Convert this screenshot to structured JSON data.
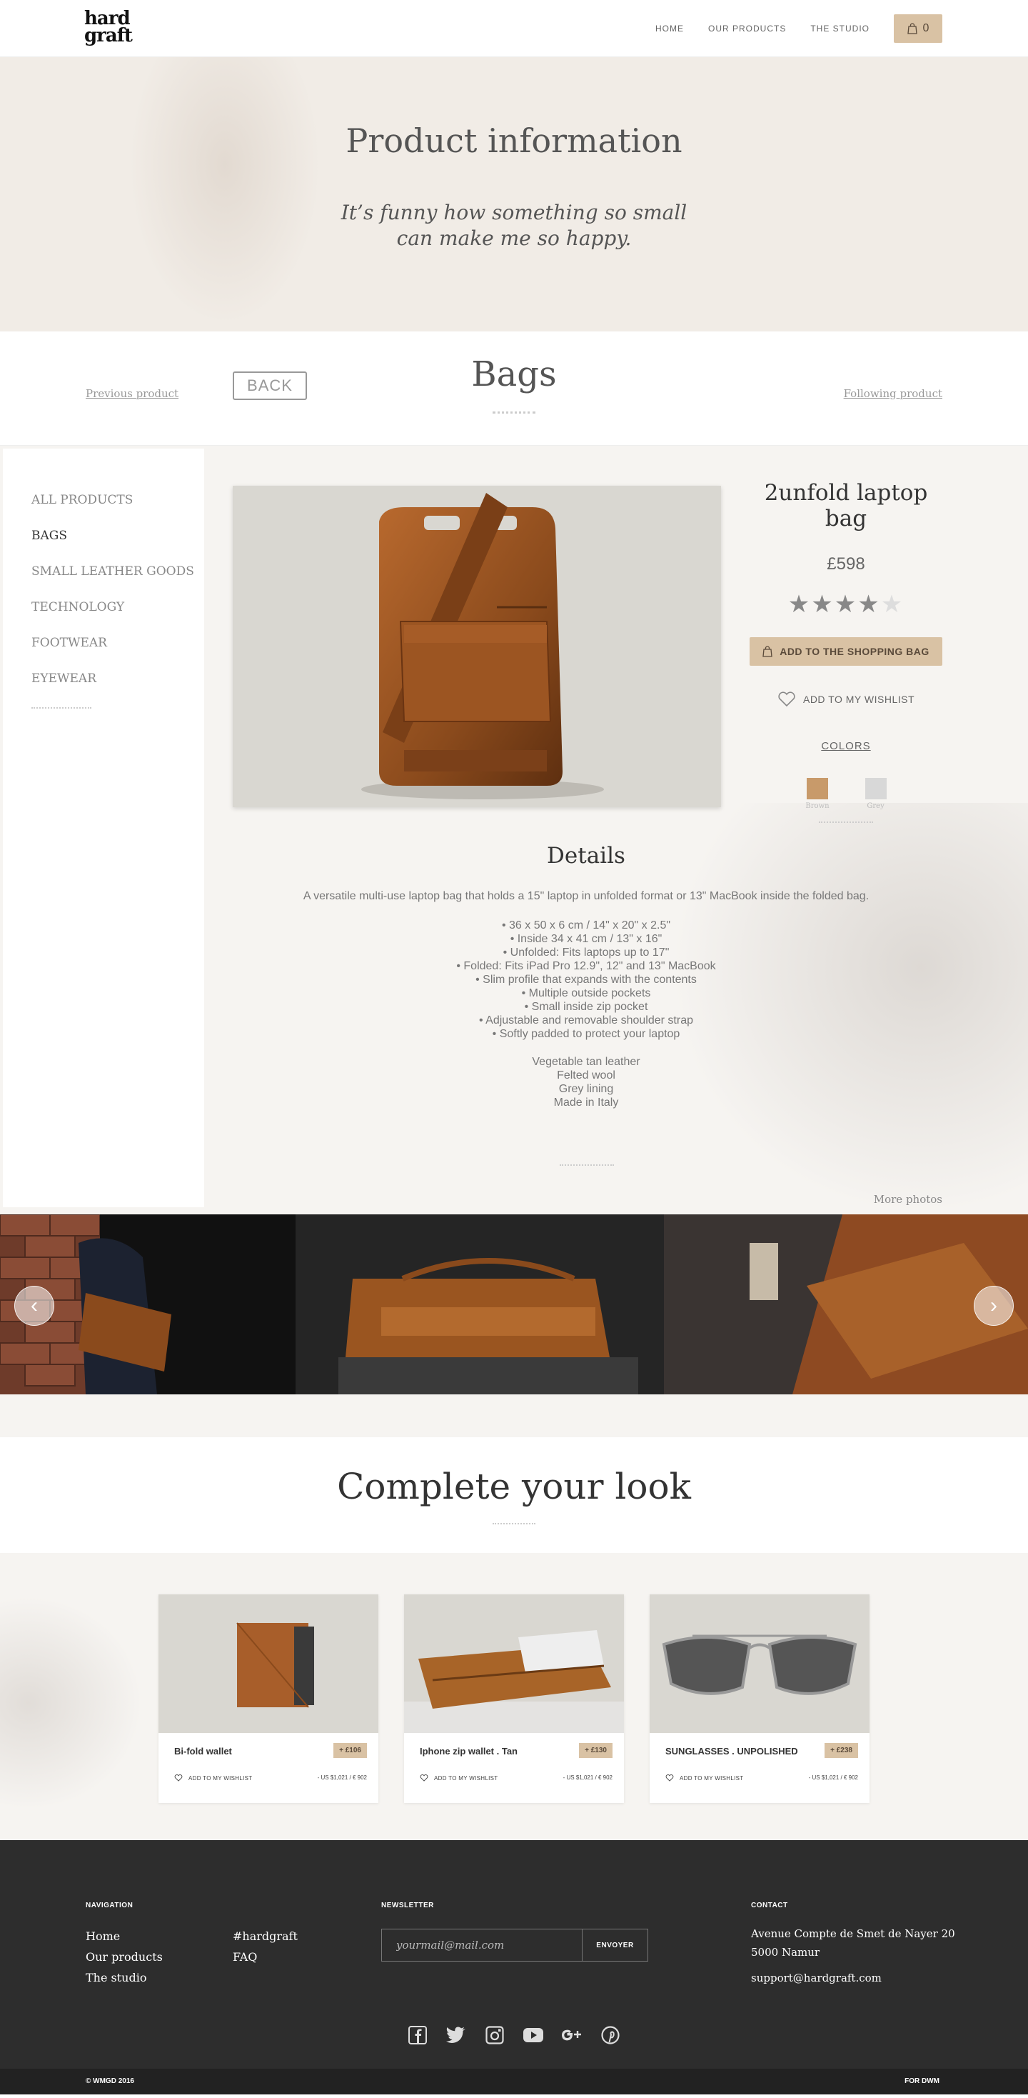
{
  "header": {
    "logo_line1": "hard",
    "logo_line2": "graft",
    "nav": [
      "HOME",
      "OUR PRODUCTS",
      "THE STUDIO"
    ],
    "bag_count": "0"
  },
  "hero": {
    "title": "Product information",
    "quote_line1": "It’s funny how something so small",
    "quote_line2": "can make me so happy."
  },
  "category": {
    "previous": "Previous product",
    "back": "BACK",
    "title": "Bags",
    "following": "Following product"
  },
  "sidebar": {
    "items": [
      "ALL PRODUCTS",
      "BAGS",
      "SMALL LEATHER GOODS",
      "TECHNOLOGY",
      "FOOTWEAR",
      "EYEWEAR"
    ],
    "active": "BAGS"
  },
  "product": {
    "name": "2unfold laptop bag",
    "price": "£598",
    "rating": 4,
    "rating_max": 5,
    "add_to_bag": "ADD TO THE SHOPPING BAG",
    "wishlist": "ADD TO MY WISHLIST",
    "colors_title": "COLORS",
    "colors": [
      {
        "label": "Brown",
        "hex": "#c89a6a"
      },
      {
        "label": "Grey",
        "hex": "#d8d8d8"
      }
    ]
  },
  "details": {
    "title": "Details",
    "description": "A versatile multi-use laptop bag that holds a 15\" laptop in unfolded format or 13\" MacBook inside the folded bag.",
    "features": [
      "• 36 x 50 x 6 cm / 14\" x 20\" x 2.5\"",
      "• Inside 34 x 41 cm / 13\" x 16\"",
      "• Unfolded: Fits laptops up to 17\"",
      "• Folded: Fits iPad Pro 12.9\", 12\" and 13\" MacBook",
      "• Slim profile that expands with the contents",
      "• Multiple outside pockets",
      "• Small inside zip pocket",
      "• Adjustable and removable shoulder strap",
      "• Softly padded to protect your laptop"
    ],
    "materials": [
      "Vegetable tan leather",
      "Felted wool",
      "Grey lining",
      "Made in Italy"
    ],
    "more_photos": "More photos"
  },
  "look": {
    "title": "Complete your look",
    "cards": [
      {
        "name": "Bi-fold wallet",
        "price": "+ £106",
        "wishlist": "ADD TO MY WISHLIST",
        "conversion": "- US $1,021 / € 902"
      },
      {
        "name": "Iphone zip wallet . Tan",
        "price": "+ £130",
        "wishlist": "ADD TO MY WISHLIST",
        "conversion": "- US $1,021 / € 902"
      },
      {
        "name": "SUNGLASSES . UNPOLISHED",
        "price": "+ £238",
        "wishlist": "ADD TO MY WISHLIST",
        "conversion": "- US $1,021 / € 902"
      }
    ]
  },
  "footer": {
    "nav_title": "NAVIGATION",
    "nav_col1": [
      "Home",
      "Our products",
      "The studio"
    ],
    "nav_col2": [
      "#hardgraft",
      "FAQ"
    ],
    "newsletter_title": "NEWSLETTER",
    "newsletter_placeholder": "yourmail@mail.com",
    "newsletter_button": "ENVOYER",
    "contact_title": "CONTACT",
    "address_line1": "Avenue Compte de Smet de Nayer 20",
    "address_line2": "5000 Namur",
    "email": "support@hardgraft.com",
    "socials": [
      "facebook-icon",
      "twitter-icon",
      "instagram-icon",
      "youtube-icon",
      "google-plus-icon",
      "pinterest-icon"
    ],
    "copyright": "© WMGD 2016",
    "credit": "FOR DWM"
  },
  "colors": {
    "accent": "#d9c2a4",
    "hero_bg": "#f1ece6",
    "footer_bg": "#2d2d2d"
  }
}
